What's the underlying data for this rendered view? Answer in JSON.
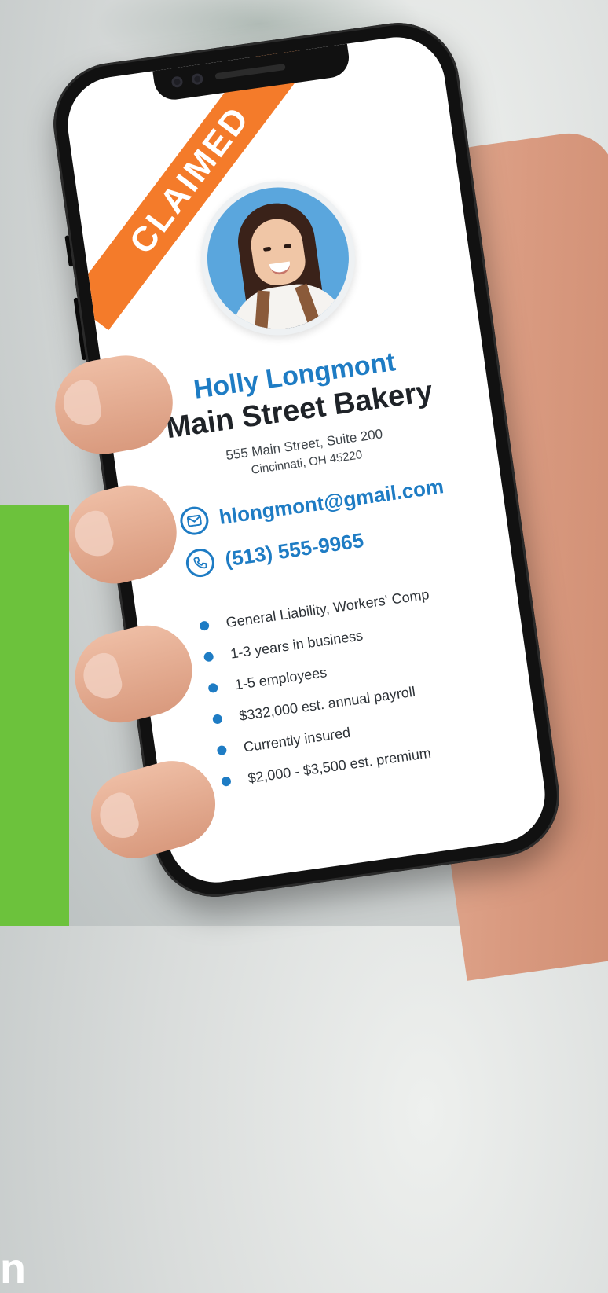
{
  "badge": {
    "label": "CLAIMED",
    "color": "#f47b2a"
  },
  "profile": {
    "name": "Holly Longmont",
    "business": "Main Street Bakery",
    "address_line1": "555 Main Street, Suite 200",
    "address_line2": "Cincinnati, OH 45220",
    "avatar_icon": "profile-photo"
  },
  "contact": {
    "email": "hlongmont@gmail.com",
    "email_icon": "envelope-icon",
    "phone": "(513) 555-9965",
    "phone_icon": "phone-icon"
  },
  "details": [
    "General Liability, Workers' Comp",
    "1-3 years in business",
    "1-5 employees",
    "$332,000 est. annual payroll",
    "Currently insured",
    "$2,000 - $3,500 est. premium"
  ],
  "side_panel": {
    "text": "n",
    "color": "#6cc23c"
  },
  "colors": {
    "accent": "#1e7cc4",
    "badge": "#f47b2a",
    "panel": "#6cc23c"
  }
}
